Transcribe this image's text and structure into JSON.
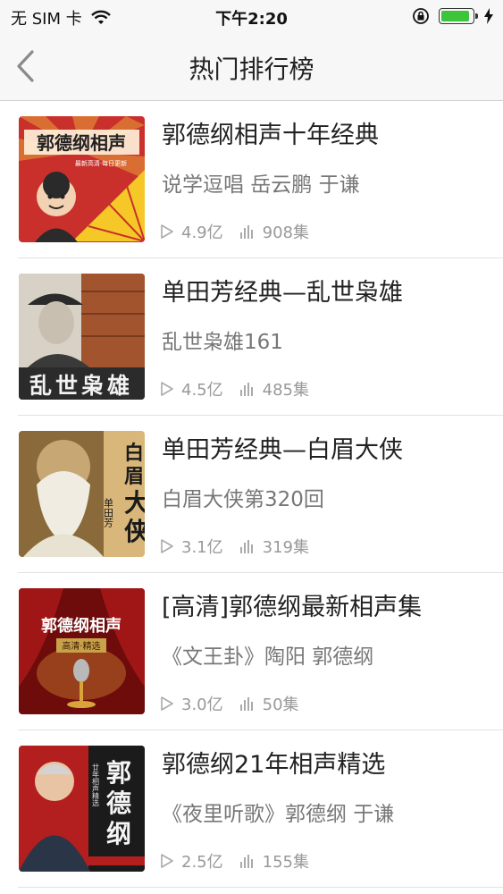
{
  "status": {
    "carrier": "无 SIM 卡",
    "time": "下午2:20",
    "battery_level": 0.95,
    "battery_color": "#3cc43c"
  },
  "nav": {
    "title": "热门排行榜",
    "back_icon": "chevron-left-icon"
  },
  "items": [
    {
      "title": "郭德纲相声十年经典",
      "subtitle": "说学逗唱 岳云鹏 于谦",
      "plays": "4.9亿",
      "episodes": "908集",
      "cover_text": "郭德纲相声",
      "cover_tag": "最新高清·每日更新"
    },
    {
      "title": "单田芳经典—乱世枭雄",
      "subtitle": "乱世枭雄161",
      "plays": "4.5亿",
      "episodes": "485集",
      "cover_text": "乱世枭雄"
    },
    {
      "title": "单田芳经典—白眉大侠",
      "subtitle": "白眉大侠第320回",
      "plays": "3.1亿",
      "episodes": "319集",
      "cover_text": "白眉大侠",
      "cover_tag": "单田芳"
    },
    {
      "title": "[高清]郭德纲最新相声集",
      "subtitle": "《文王卦》陶阳 郭德纲",
      "plays": "3.0亿",
      "episodes": "50集",
      "cover_text": "郭德纲相声",
      "cover_tag": "高清·精选"
    },
    {
      "title": "郭德纲21年相声精选",
      "subtitle": "《夜里听歌》郭德纲 于谦",
      "plays": "2.5亿",
      "episodes": "155集",
      "cover_text": "郭德纲",
      "cover_tag": "廿年相声精选"
    }
  ]
}
